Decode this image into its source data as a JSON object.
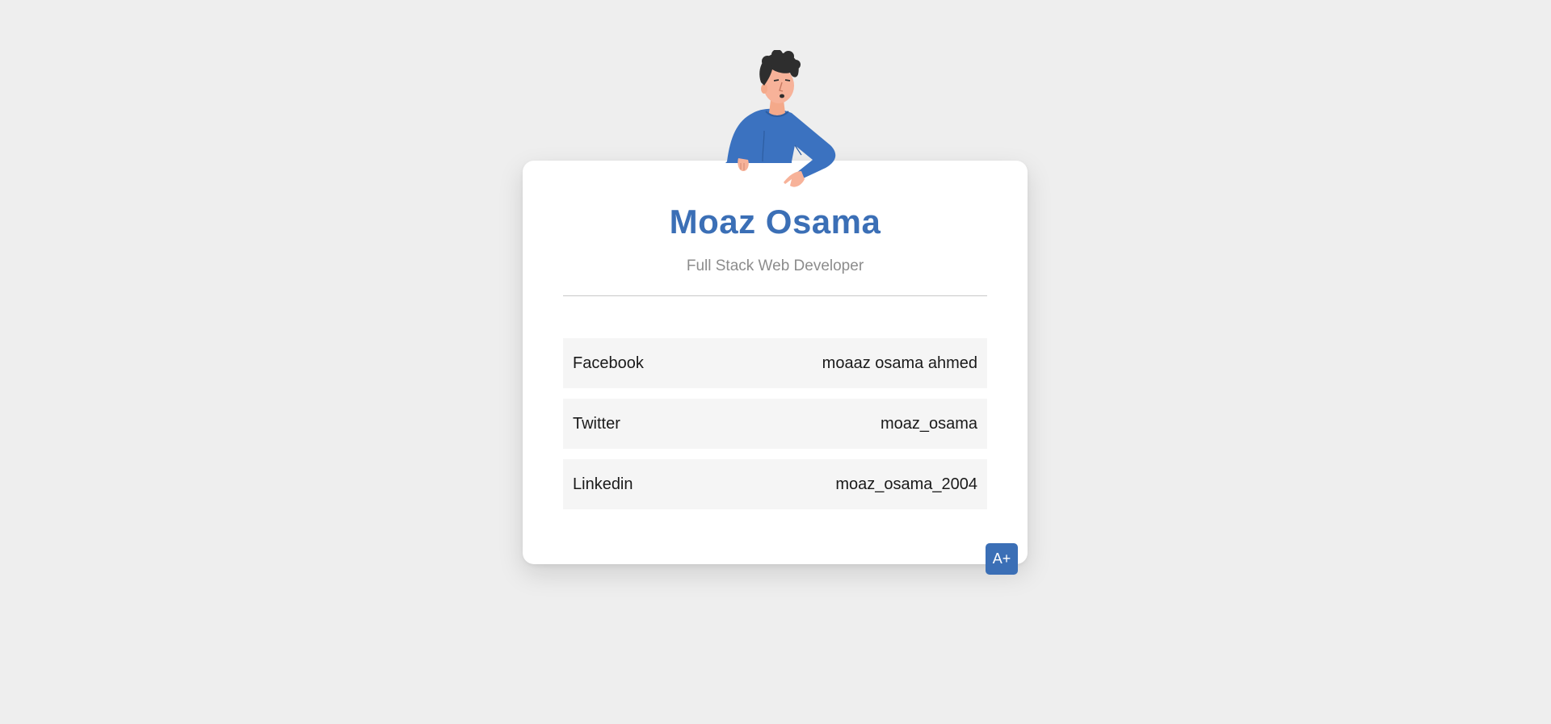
{
  "profile": {
    "name": "Moaz Osama",
    "title": "Full Stack Web Developer"
  },
  "links": [
    {
      "label": "Facebook",
      "value": "moaaz osama ahmed"
    },
    {
      "label": "Twitter",
      "value": "moaz_osama"
    },
    {
      "label": "Linkedin",
      "value": "moaz_osama_2004"
    }
  ],
  "badge": {
    "label": "A+"
  },
  "illustration": {
    "icon": "person-illustration-icon"
  },
  "colors": {
    "accent": "#3b6fb6",
    "background": "#eeeeee",
    "card": "#ffffff",
    "row": "#f5f5f5",
    "subtitle": "#8c8c8c"
  }
}
